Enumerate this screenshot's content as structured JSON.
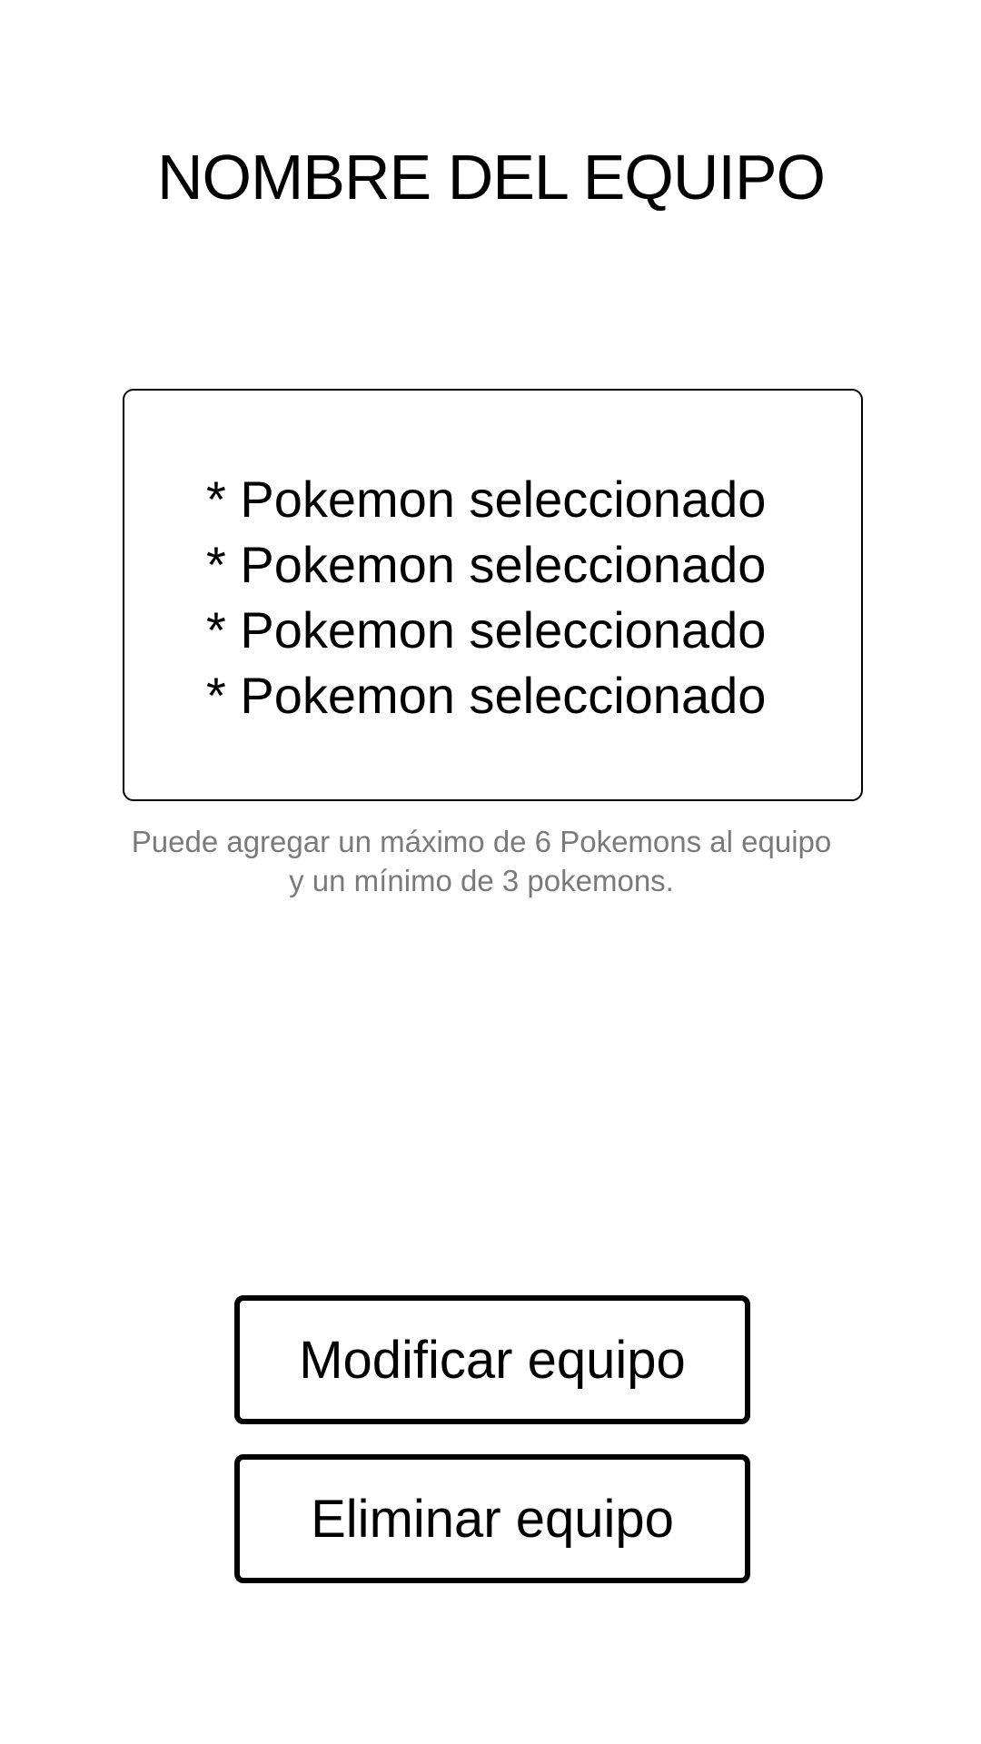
{
  "team": {
    "name": "NOMBRE DEL EQUIPO"
  },
  "pokemon_list": [
    {
      "label": "* Pokemon seleccionado"
    },
    {
      "label": "* Pokemon seleccionado"
    },
    {
      "label": "* Pokemon seleccionado"
    },
    {
      "label": "* Pokemon seleccionado"
    }
  ],
  "hint": {
    "line1": "Puede agregar un máximo de 6 Pokemons al equipo",
    "line2": "y un mínimo de 3 pokemons."
  },
  "actions": {
    "modify_label": "Modificar equipo",
    "delete_label": "Eliminar equipo"
  }
}
